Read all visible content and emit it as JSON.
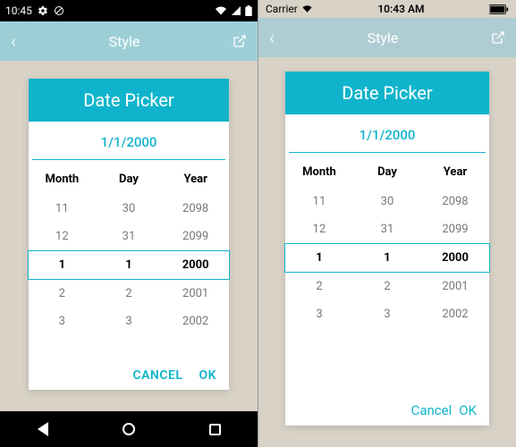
{
  "android": {
    "status": {
      "time": "10:45",
      "gearIcon": "gear",
      "circleIcon": "circle"
    },
    "header": {
      "title": "Style"
    },
    "card": {
      "title": "Date Picker",
      "dateDisplay": "1/1/2000",
      "columns": {
        "month": "Month",
        "day": "Day",
        "year": "Year"
      },
      "rows": [
        {
          "month": "11",
          "day": "30",
          "year": "2098",
          "selected": false
        },
        {
          "month": "12",
          "day": "31",
          "year": "2099",
          "selected": false
        },
        {
          "month": "1",
          "day": "1",
          "year": "2000",
          "selected": true
        },
        {
          "month": "2",
          "day": "2",
          "year": "2001",
          "selected": false
        },
        {
          "month": "3",
          "day": "3",
          "year": "2002",
          "selected": false
        }
      ],
      "cancel": "CANCEL",
      "ok": "OK"
    }
  },
  "ios": {
    "status": {
      "carrier": "Carrier",
      "time": "10:43 AM"
    },
    "header": {
      "title": "Style"
    },
    "card": {
      "title": "Date Picker",
      "dateDisplay": "1/1/2000",
      "columns": {
        "month": "Month",
        "day": "Day",
        "year": "Year"
      },
      "rows": [
        {
          "month": "11",
          "day": "30",
          "year": "2098",
          "selected": false
        },
        {
          "month": "12",
          "day": "31",
          "year": "2099",
          "selected": false
        },
        {
          "month": "1",
          "day": "1",
          "year": "2000",
          "selected": true
        },
        {
          "month": "2",
          "day": "2",
          "year": "2001",
          "selected": false
        },
        {
          "month": "3",
          "day": "3",
          "year": "2002",
          "selected": false
        }
      ],
      "cancel": "Cancel",
      "ok": "OK"
    }
  }
}
